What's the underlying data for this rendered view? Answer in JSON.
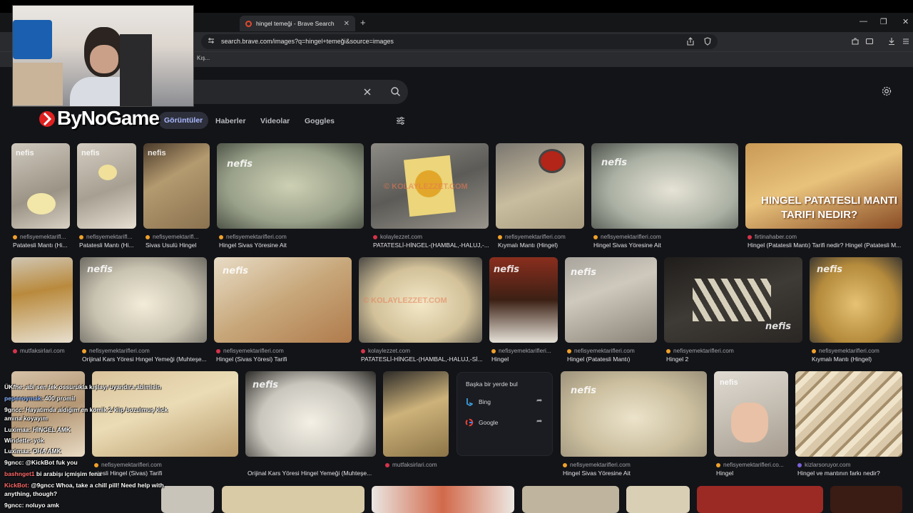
{
  "browser": {
    "tab_title": "hingel temeği - Brave Search",
    "tab_close": "✕",
    "new_tab": "+",
    "url": "search.brave.com/images?q=hingel+temeği&source=images",
    "bookmark_fragment": "Kış...",
    "window_controls": [
      "—",
      "❐",
      "✕"
    ]
  },
  "search": {
    "tabs": [
      "Görüntüler",
      "Haberler",
      "Videolar",
      "Goggles"
    ],
    "active_tab": "Görüntüler"
  },
  "overlay": {
    "logo_text": "ByNoGame"
  },
  "results_row1": [
    {
      "source": "nefisyemektarifl...",
      "title": "Patatesli Mantı (Hi...",
      "color": "#f0a12b"
    },
    {
      "source": "nefisyemektarifl...",
      "title": "Patatesli Mantı (Hi...",
      "color": "#f0a12b"
    },
    {
      "source": "nefisyemektarifl...",
      "title": "Sivas Usulü Hingel",
      "color": "#f0a12b"
    },
    {
      "source": "nefisyemektarifleri.com",
      "title": "Hingel Sivas Yöresine Ait",
      "color": "#f0a12b"
    },
    {
      "source": "kolaylezzet.com",
      "title": "PATATESLİ-HİNGEL-(HAMBAL,-HALUJ,-...",
      "color": "#d6334a"
    },
    {
      "source": "nefisyemektarifleri.com",
      "title": "Kıymalı Mantı (Hingel)",
      "color": "#f0a12b"
    },
    {
      "source": "nefisyemektarifleri.com",
      "title": "Hingel Sivas Yöresine Ait",
      "color": "#f0a12b"
    },
    {
      "source": "firtinahaber.com",
      "title": "Hingel (Patatesli Mantı) Tarifi nedir? Hingel (Patatesli M...",
      "color": "#d6334a"
    }
  ],
  "results_row2": [
    {
      "source": "mutfaksirlari.com",
      "title": "",
      "color": "#d6334a"
    },
    {
      "source": "nefisyemektarifleri.com",
      "title": "Orijinal Kars Yöresi Hıngel Yemeği (Muhteşe...",
      "color": "#f0a12b"
    },
    {
      "source": "nefisyemektarifleri.com",
      "title": "Hingel (Sivas Yöresi) Tarifi",
      "color": "#d6334a"
    },
    {
      "source": "kolaylezzet.com",
      "title": "PATATESLİ-HİNGEL-(HAMBAL,-HALUJ,-Sİ...",
      "color": "#d6334a"
    },
    {
      "source": "nefisyemektarifleri...",
      "title": "Hingel",
      "color": "#f0a12b"
    },
    {
      "source": "nefisyemektarifleri.com",
      "title": "Hingel (Patatesli Mantı)",
      "color": "#f0a12b"
    },
    {
      "source": "nefisyemektarifleri.com",
      "title": "Hingel 2",
      "color": "#f0a12b"
    },
    {
      "source": "nefisyemektarifleri.com",
      "title": "Kıymalı Mantı (Hingel)",
      "color": "#f0a12b"
    }
  ],
  "results_row3": [
    {
      "source": "nefisyemektarifleri.com",
      "title": "atesli Hingel (Sivas) Tarifi",
      "color": "#f0a12b"
    },
    {
      "source": "",
      "title": "Orijinal Kars Yöresi Hingel Yemeği (Muhteşe...",
      "color": "#f0a12b"
    },
    {
      "source": "mutfaksirlari.com",
      "title": "",
      "color": "#d6334a"
    },
    {
      "source": "nefisyemektarifleri.com",
      "title": "Hingel Sivas Yöresine Ait",
      "color": "#f0a12b"
    },
    {
      "source": "nefisyemektarifleri.co...",
      "title": "Hingel",
      "color": "#f0a12b"
    },
    {
      "source": "kizlarsoruyor.com",
      "title": "Hingel ve mantının farkı nedir?",
      "color": "#7b61d9"
    }
  ],
  "find_elsewhere": {
    "title": "Başka bir yerde bul",
    "items": [
      "Bing",
      "Google"
    ]
  },
  "watermarks": {
    "nefis": "nefis",
    "nefis_sub": "yemek tarifleri",
    "kolay": "© KOLAYLEZZET.COM",
    "hingel_banner_1": "HINGEL PATATESLI MANTI",
    "hingel_banner_2": "TARIFI NEDIR?"
  },
  "chat": [
    {
      "user": "",
      "text": "ÜKfhe: abi sen tek ossurukla kışlayı uyandıra abimisin",
      "color": "#ffffff"
    },
    {
      "user": "pepeeoymak:",
      "text": "400 promil",
      "color": "#8ab4ff"
    },
    {
      "user": "9gncc:",
      "text": "Hayatımda aldığım en komik 2 klip bozulmuş kick",
      "color": "#ffffff"
    },
    {
      "user": "",
      "text": "amına koyayım",
      "color": "#ffffff"
    },
    {
      "user": "Luximaa:",
      "text": "HİNGEL AMK",
      "color": "#ffffff"
    },
    {
      "user": "Windette:",
      "text": "yok",
      "color": "#ffffff"
    },
    {
      "user": "Luximaa:",
      "text": "OHA AMK",
      "color": "#ffffff"
    },
    {
      "user": "9gncc:",
      "text": "@KickBot fuk you",
      "color": "#ffffff"
    },
    {
      "user": "bashnget1",
      "text": "bi arabişı içmişim fena",
      "color": "#ff6b6b"
    },
    {
      "user": "KickBot:",
      "text": "@9gncc Whoa, take a chill pill! Need help with",
      "color": "#ff6b6b"
    },
    {
      "user": "",
      "text": "anything, though?",
      "color": "#ffffff"
    },
    {
      "user": "9gncc:",
      "text": "noluyo amk",
      "color": "#ffffff"
    }
  ]
}
